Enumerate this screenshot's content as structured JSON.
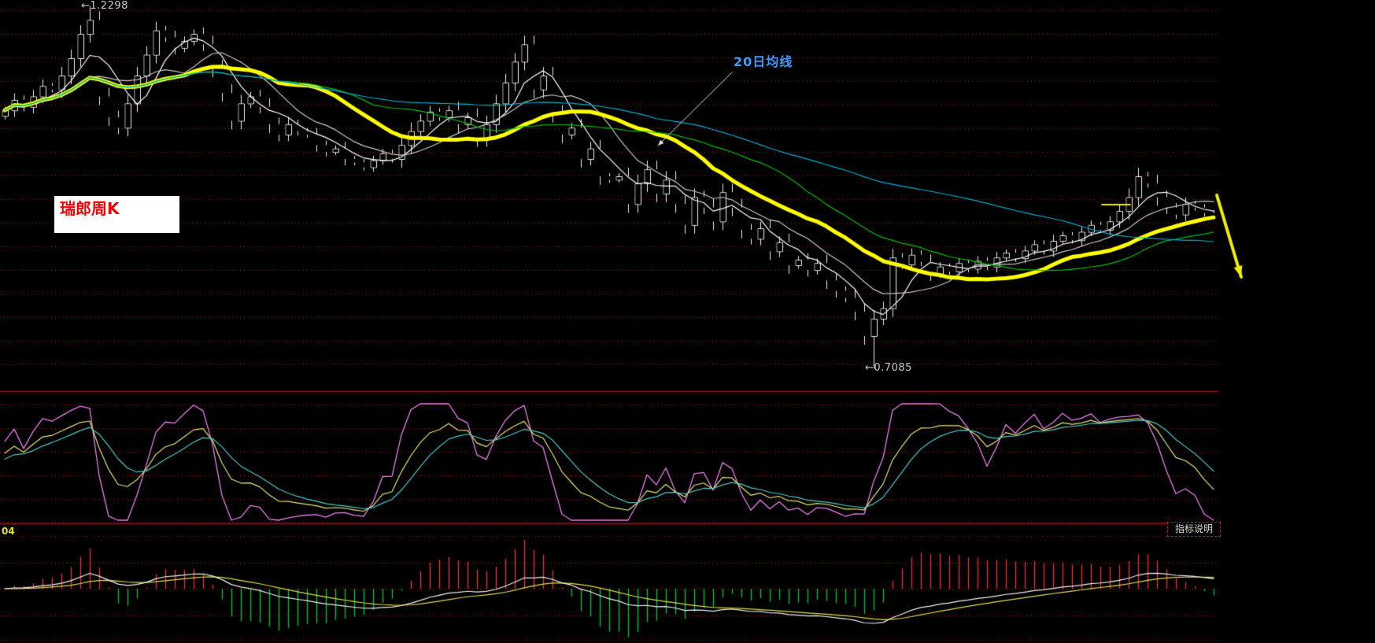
{
  "labels": {
    "title": "瑞郎周K",
    "high": "←1.2298",
    "low": "←0.7085",
    "ma20": "20日均线",
    "period": "04",
    "indicator_button": "指标说明"
  },
  "colors": {
    "background": "#000000",
    "grid": "#C80000",
    "divider": "#C80000",
    "up_candle": "#E63232",
    "down_candle": "#58DCE6",
    "high_low_label": "#C8C8C8",
    "title_text": "#F00000",
    "title_box_bg": "#FFFFFF",
    "ma20_label": "#3C9CFF",
    "period_label": "#E8E800",
    "indicator_button_text": "#DCDCDC",
    "indicator_button_border": "#DC0000"
  },
  "chart_data": [
    {
      "type": "candlestick",
      "title": "瑞郎周K",
      "timeframe": "weekly",
      "high_point": {
        "index": 9,
        "price": 1.2298,
        "label": "1.2298"
      },
      "low_point": {
        "index": 92,
        "price": 0.7085,
        "label": "0.7085"
      },
      "closes": [
        1.08,
        1.095,
        1.085,
        1.1,
        1.115,
        1.11,
        1.13,
        1.155,
        1.19,
        1.21,
        1.1,
        1.07,
        1.055,
        1.09,
        1.13,
        1.16,
        1.195,
        1.185,
        1.17,
        1.18,
        1.19,
        1.175,
        1.14,
        1.105,
        1.065,
        1.09,
        1.1,
        1.085,
        1.06,
        1.045,
        1.06,
        1.05,
        1.045,
        1.03,
        1.02,
        1.025,
        1.01,
        1.005,
        0.998,
        1.008,
        1.018,
        1.01,
        1.03,
        1.05,
        1.065,
        1.078,
        1.07,
        1.08,
        1.06,
        1.07,
        1.04,
        1.06,
        1.09,
        1.12,
        1.15,
        1.175,
        1.11,
        1.13,
        1.075,
        1.045,
        1.055,
        1.01,
        1.025,
        0.985,
        0.98,
        0.985,
        0.945,
        0.975,
        0.995,
        0.96,
        0.98,
        0.945,
        0.915,
        0.955,
        0.94,
        0.92,
        0.962,
        0.94,
        0.908,
        0.895,
        0.91,
        0.877,
        0.89,
        0.857,
        0.865,
        0.85,
        0.86,
        0.835,
        0.82,
        0.81,
        0.79,
        0.755,
        0.78,
        0.795,
        0.868,
        0.858,
        0.872,
        0.862,
        0.845,
        0.855,
        0.848,
        0.86,
        0.852,
        0.863,
        0.855,
        0.868,
        0.875,
        0.867,
        0.878,
        0.887,
        0.878,
        0.892,
        0.9,
        0.893,
        0.905,
        0.915,
        0.908,
        0.92,
        0.935,
        0.955,
        0.985,
        0.975,
        0.955,
        0.94,
        0.93,
        0.945,
        0.94,
        0.932,
        0.928
      ],
      "moving_averages": [
        {
          "name": "MA5",
          "period": 5,
          "color": "#FFFFFF",
          "thick": false
        },
        {
          "name": "MA10",
          "period": 10,
          "color": "#C8C8C8",
          "thick": false
        },
        {
          "name": "MA20",
          "period": 20,
          "color": "#FFFF00",
          "thick": true,
          "label": "20日均线"
        },
        {
          "name": "MA30",
          "period": 30,
          "color": "#00BE00",
          "thick": false
        },
        {
          "name": "MA60",
          "period": 60,
          "color": "#00AED2",
          "thick": false
        }
      ],
      "grid": true,
      "ylim": [
        0.7,
        1.24
      ]
    },
    {
      "type": "line",
      "name": "KDJ",
      "params": [
        9,
        3,
        3
      ],
      "range": [
        0,
        100
      ],
      "series": [
        {
          "name": "K",
          "color": "#E6E678"
        },
        {
          "name": "D",
          "color": "#50C8C8"
        },
        {
          "name": "J",
          "color": "#E882E8"
        }
      ]
    },
    {
      "type": "macd",
      "name": "MACD",
      "params": [
        12,
        26,
        9
      ],
      "series": [
        {
          "name": "DIF",
          "color": "#F0F0F0"
        },
        {
          "name": "DEA",
          "color": "#DCDC50"
        }
      ],
      "bar_up_color": "#E63232",
      "bar_down_color": "#00BE3C"
    }
  ],
  "drawn_annotations": [
    {
      "name": "ma20-callout-arrow",
      "type": "arrow",
      "color": "#E8E8E8",
      "from": [
        930,
        92
      ],
      "to": [
        836,
        185
      ],
      "width": 1
    },
    {
      "name": "forecast-down-arrow",
      "type": "arrow",
      "color": "#F0F000",
      "from": [
        1546,
        248
      ],
      "to": [
        1577,
        352
      ],
      "width": 4
    },
    {
      "name": "level-segment",
      "type": "line",
      "color": "#E8E800",
      "from": [
        1400,
        260
      ],
      "to": [
        1436,
        260
      ],
      "width": 2
    }
  ]
}
